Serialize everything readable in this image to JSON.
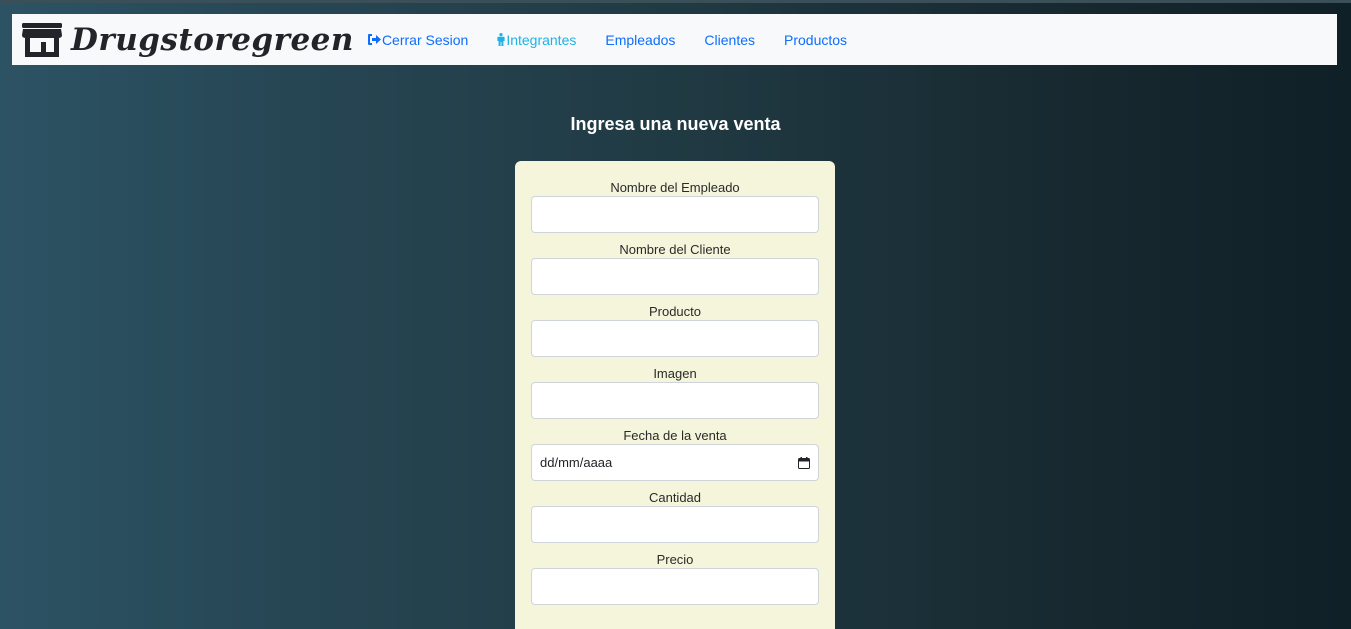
{
  "brand": {
    "name": "Drugstoregreen",
    "icon": "store-icon"
  },
  "nav": {
    "items": [
      {
        "label": "Cerrar Sesion",
        "icon": "sign-out-icon",
        "color": "#0d6efd"
      },
      {
        "label": "Integrantes",
        "icon": "person-icon",
        "color": "#20b2e6"
      },
      {
        "label": "Empleados"
      },
      {
        "label": "Clientes"
      },
      {
        "label": "Productos"
      }
    ]
  },
  "form": {
    "title": "Ingresa una nueva venta",
    "fields": [
      {
        "label": "Nombre del Empleado",
        "value": ""
      },
      {
        "label": "Nombre del Cliente",
        "value": ""
      },
      {
        "label": "Producto",
        "value": ""
      },
      {
        "label": "Imagen",
        "value": ""
      },
      {
        "label": "Fecha de la venta",
        "value": "dd/mm/aaaa",
        "icon": "calendar-icon"
      },
      {
        "label": "Cantidad",
        "value": ""
      },
      {
        "label": "Precio",
        "value": ""
      }
    ]
  },
  "colors": {
    "card_background": "#f5f5dc",
    "link": "#0d6efd",
    "link_active": "#20b2e6",
    "gradient_start": "#2c5364",
    "gradient_end": "#0f2027"
  }
}
